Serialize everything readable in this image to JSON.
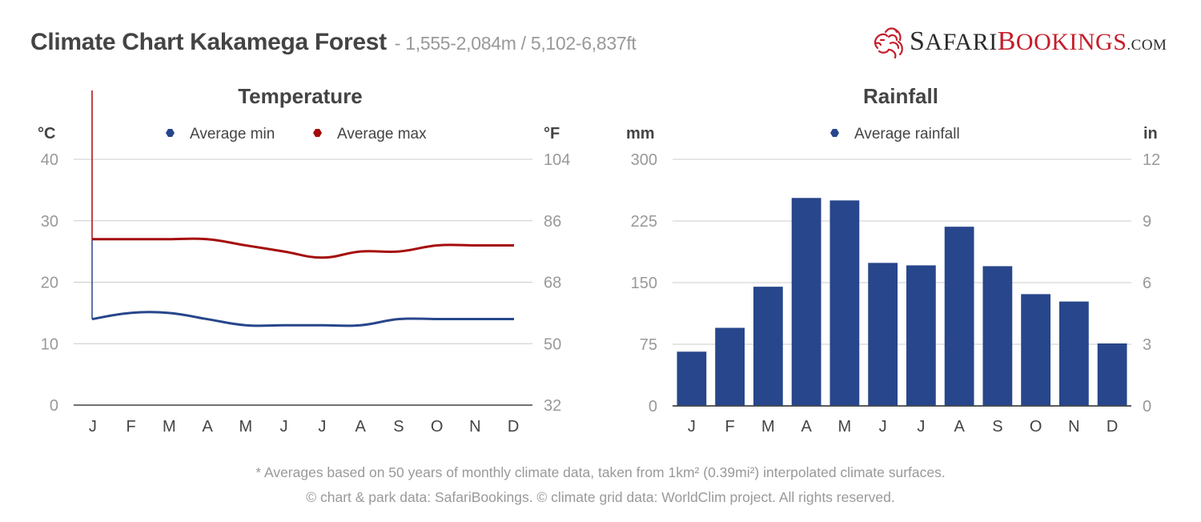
{
  "header": {
    "title": "Climate Chart Kakamega Forest",
    "subtitle": "- 1,555-2,084m / 5,102-6,837ft"
  },
  "logo": {
    "part1_initial": "S",
    "part1_rest": "AFARI",
    "part2_initial": "B",
    "part2_rest": "OOKINGS",
    "suffix": ".COM",
    "icon": "lion-head-icon",
    "colors": {
      "dark": "#2b2b2b",
      "red": "#c41e2a"
    }
  },
  "footer": {
    "note": "* Averages based on 50 years of monthly climate data, taken from 1km² (0.39mi²) interpolated climate surfaces.",
    "copyright": "© chart & park data: SafariBookings. © climate grid data: WorldClim project. All rights reserved."
  },
  "chart_data": [
    {
      "type": "line",
      "title": "Temperature",
      "ylabel_left": "°C",
      "ylabel_right": "°F",
      "categories": [
        "J",
        "F",
        "M",
        "A",
        "M",
        "J",
        "J",
        "A",
        "S",
        "O",
        "N",
        "D"
      ],
      "ylim": [
        0,
        40
      ],
      "yticks_left": [
        "0",
        "10",
        "20",
        "30",
        "40"
      ],
      "yticks_right": [
        "32",
        "50",
        "68",
        "86",
        "104"
      ],
      "grid": true,
      "legend_position": "top-center",
      "series": [
        {
          "name": "Average min",
          "color": "#27468b",
          "values": [
            14,
            15,
            15,
            14,
            13,
            13,
            13,
            13,
            14,
            14,
            14,
            14
          ]
        },
        {
          "name": "Average max",
          "color": "#a50c0c",
          "values": [
            27,
            27,
            27,
            27,
            26,
            25,
            24,
            25,
            25,
            26,
            26,
            26
          ]
        }
      ]
    },
    {
      "type": "bar",
      "title": "Rainfall",
      "ylabel_left": "mm",
      "ylabel_right": "in",
      "categories": [
        "J",
        "F",
        "M",
        "A",
        "M",
        "J",
        "J",
        "A",
        "S",
        "O",
        "N",
        "D"
      ],
      "ylim": [
        0,
        300
      ],
      "yticks_left": [
        "0",
        "75",
        "150",
        "225",
        "300"
      ],
      "yticks_right": [
        "0",
        "3",
        "6",
        "9",
        "12"
      ],
      "grid": true,
      "legend_position": "top-center",
      "series": [
        {
          "name": "Average rainfall",
          "color": "#27468b",
          "values": [
            66,
            95,
            145,
            253,
            250,
            174,
            171,
            218,
            170,
            136,
            127,
            76
          ]
        }
      ]
    }
  ]
}
